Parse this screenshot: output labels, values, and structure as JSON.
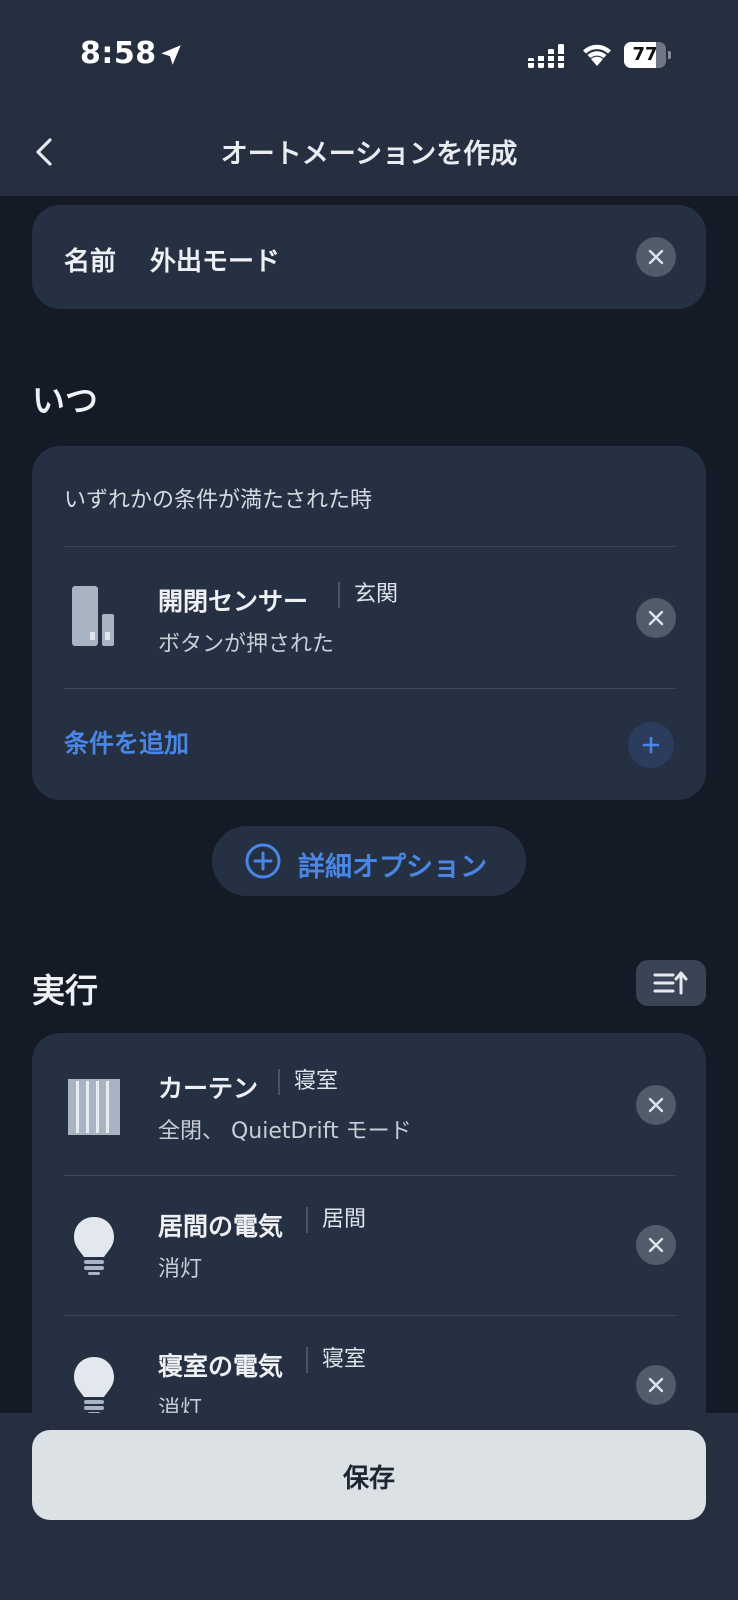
{
  "status_bar": {
    "time": "8:58",
    "battery": "77",
    "battery_level": 0.77,
    "icons": [
      "location-arrow-icon",
      "signal-icon",
      "wifi-icon",
      "battery-icon"
    ]
  },
  "nav": {
    "title": "オートメーションを作成",
    "back_icon": "chevron-left-icon"
  },
  "name_card": {
    "label": "名前",
    "value": "外出モード"
  },
  "when": {
    "title": "いつ",
    "description": "いずれかの条件が満たされた時",
    "conditions": [
      {
        "icon": "door-sensor-icon",
        "title": "開閉センサー",
        "room": "玄関",
        "subtitle": "ボタンが押された"
      }
    ],
    "add_label": "条件を追加"
  },
  "detail_option": {
    "label": "詳細オプション"
  },
  "execute": {
    "title": "実行",
    "sort_icon": "sort-icon",
    "actions": [
      {
        "icon": "curtain-icon",
        "title": "カーテン",
        "room": "寝室",
        "subtitle": "全閉、 QuietDrift モード"
      },
      {
        "icon": "light-bulb-icon",
        "title": "居間の電気",
        "room": "居間",
        "subtitle": "消灯"
      },
      {
        "icon": "light-bulb-icon",
        "title": "寝室の電気",
        "room": "寝室",
        "subtitle": "消灯"
      }
    ]
  },
  "save_label": "保存",
  "colors": {
    "background": "#141b26",
    "card": "#253042",
    "header": "#252f40",
    "accent": "#4a86e6",
    "save_button": "#dce1e6"
  }
}
